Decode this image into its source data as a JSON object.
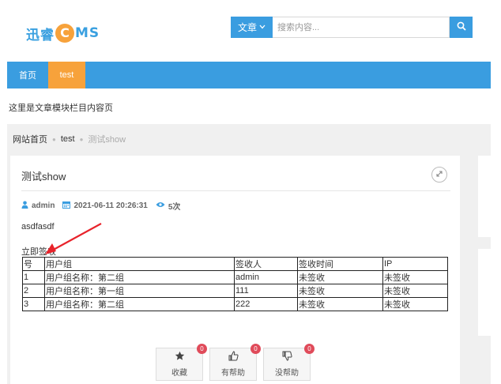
{
  "logo": {
    "prefix": "迅睿",
    "circle": "C",
    "suffix": "MS"
  },
  "search": {
    "type_label": "文章",
    "placeholder": "搜索内容..."
  },
  "nav": {
    "items": [
      {
        "label": "首页"
      },
      {
        "label": "test"
      }
    ]
  },
  "page_desc": "这里是文章模块栏目内容页",
  "breadcrumb": {
    "home": "网站首页",
    "category": "test",
    "current": "测试show"
  },
  "article": {
    "title": "测试show",
    "author": "admin",
    "date": "2021-06-11 20:26:31",
    "views": "5次",
    "body": "asdfasdf",
    "signin": "立即签收"
  },
  "sign_table": {
    "headers": [
      "号",
      "用户组",
      "签收人",
      "签收时间",
      "IP"
    ],
    "rows": [
      [
        "1",
        "用户组名称：第二组",
        "admin",
        "未签收",
        "未签收"
      ],
      [
        "2",
        "用户组名称：第一组",
        "111",
        "未签收",
        "未签收"
      ],
      [
        "3",
        "用户组名称：第二组",
        "222",
        "未签收",
        "未签收"
      ]
    ]
  },
  "actions": [
    {
      "label": "收藏",
      "count": "0"
    },
    {
      "label": "有帮助",
      "count": "0"
    },
    {
      "label": "没帮助",
      "count": "0"
    }
  ],
  "colors": {
    "primary": "#3a9de0",
    "accent": "#f7a23b",
    "badge": "#e04b5a",
    "arrow": "#e8232b"
  }
}
